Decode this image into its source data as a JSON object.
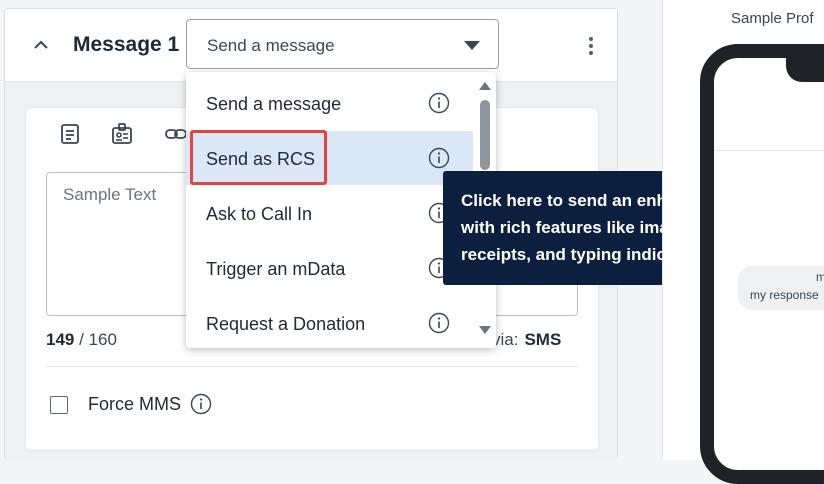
{
  "message_card": {
    "title": "Message 1",
    "action_select": {
      "value": "Send a message"
    },
    "body_placeholder": "Sample Text",
    "char_count": {
      "used": "149",
      "max": "/ 160"
    },
    "via": {
      "label": "via:",
      "channel": "SMS"
    },
    "force_mms_label": "Force MMS"
  },
  "dropdown": {
    "options": [
      {
        "label": "Send a message",
        "highlighted": false
      },
      {
        "label": "Send as RCS",
        "highlighted": true
      },
      {
        "label": "Ask to Call In",
        "highlighted": false
      },
      {
        "label": "Trigger an mData",
        "highlighted": false
      },
      {
        "label": "Request a Donation",
        "highlighted": false
      }
    ]
  },
  "tooltip": {
    "text": "Click here to send an enhanced message with rich features like images, read receipts, and typing indicators."
  },
  "preview": {
    "title": "Sample Prof",
    "bubble_text": "my response",
    "bubble_fragment": "m"
  },
  "colors": {
    "highlight": "#dbe7f7",
    "tooltip_bg": "#0c1f3f",
    "callout_border": "#e0453f"
  }
}
